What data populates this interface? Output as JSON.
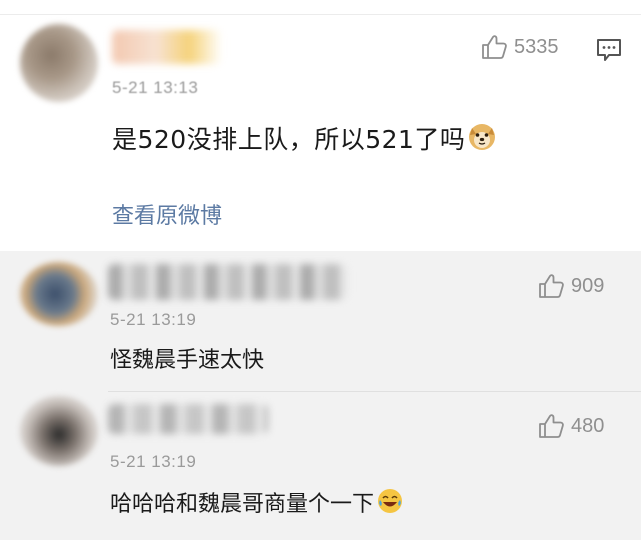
{
  "main_comment": {
    "time": "5-21 13:13",
    "likes": "5335",
    "text": "是520没排上队，所以521了吗",
    "emoji": "doge-emoji",
    "view_original_link": "查看原微博"
  },
  "replies": [
    {
      "time": "5-21 13:19",
      "likes": "909",
      "text": "怪魏晨手速太快"
    },
    {
      "time": "5-21 13:19",
      "likes": "480",
      "text": "哈哈哈和魏晨哥商量个一下",
      "emoji": "laugh-cry-emoji"
    }
  ],
  "colors": {
    "link": "#5c7aa3",
    "muted": "#9a9a9a",
    "reply_bg": "#f2f2f2"
  }
}
